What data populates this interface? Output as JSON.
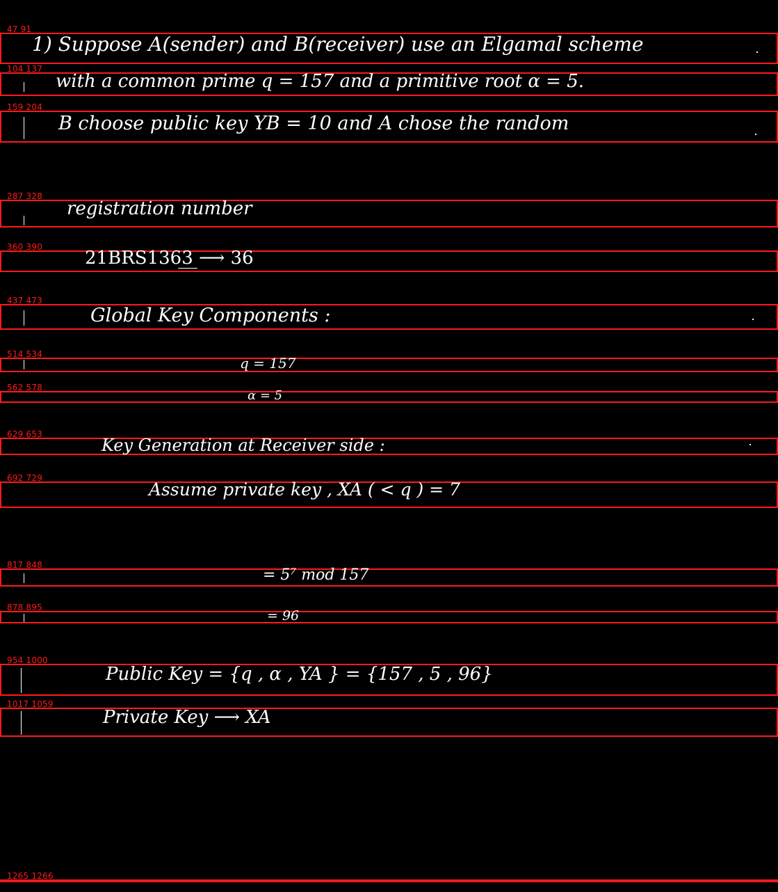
{
  "line_labels": [
    "47  91",
    "104  137",
    "159  204",
    "287  328",
    "360  390",
    "437  473",
    "514  534",
    "562  578",
    "629  653",
    "692  729",
    "817  848",
    "878  895",
    "954  1000",
    "1017  1059",
    "1265  1266"
  ],
  "text": {
    "line1": "1) Suppose A(sender) and B(receiver) use an Elgamal scheme",
    "line2": "with a common prime  q = 157  and  a  primitive  root  α = 5.",
    "line3": "B choose public key  YB  = 10 and  A  chose  the  random",
    "line4": "registration number",
    "line5": "21BRS1363 ⟶ 36",
    "line6": "Global  Key  Components :",
    "line7": "q = 157",
    "line8": "α = 5",
    "line9": "Key  Generation  at  Receiver  side :",
    "line10": "Assume  private  key ,   XA ( < q )  =  7",
    "line11": "= 5⁷  mod  157",
    "line12": "= 96",
    "line13": "Public  Key   =  {q , α , YA }  =  {157 , 5 , 96}",
    "line14": "Private  Key   ⟶  XA"
  }
}
